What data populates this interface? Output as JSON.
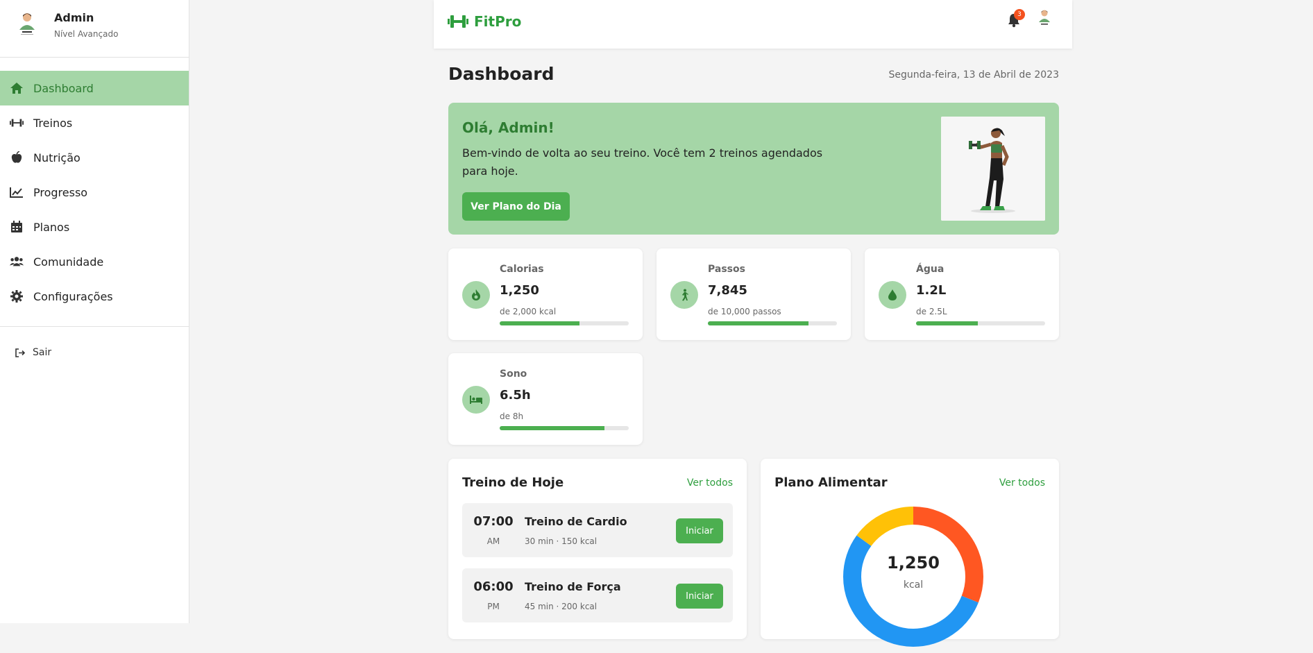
{
  "sidebar": {
    "user": {
      "name": "Admin",
      "level": "Nível Avançado"
    },
    "items": [
      {
        "label": "Dashboard",
        "icon": "home-icon",
        "active": true
      },
      {
        "label": "Treinos",
        "icon": "dumbbell-icon",
        "active": false
      },
      {
        "label": "Nutrição",
        "icon": "apple-icon",
        "active": false
      },
      {
        "label": "Progresso",
        "icon": "chart-line-icon",
        "active": false
      },
      {
        "label": "Planos",
        "icon": "calendar-icon",
        "active": false
      },
      {
        "label": "Comunidade",
        "icon": "users-icon",
        "active": false
      },
      {
        "label": "Configurações",
        "icon": "gear-icon",
        "active": false
      }
    ],
    "logout_label": "Sair"
  },
  "topbar": {
    "brand": "FitPro",
    "notification_count": "3"
  },
  "header": {
    "title": "Dashboard",
    "date": "Segunda-feira, 13 de Abril de 2023"
  },
  "banner": {
    "title": "Olá, Admin!",
    "text": "Bem-vindo de volta ao seu treino. Você tem 2 treinos agendados para hoje.",
    "button": "Ver Plano do Dia"
  },
  "stats": [
    {
      "label": "Calorias",
      "value": "1,250",
      "sub": "de 2,000 kcal",
      "progress": 0.62,
      "icon": "fire-icon"
    },
    {
      "label": "Passos",
      "value": "7,845",
      "sub": "de 10,000 passos",
      "progress": 0.78,
      "icon": "walking-icon"
    },
    {
      "label": "Água",
      "value": "1.2L",
      "sub": "de 2.5L",
      "progress": 0.48,
      "icon": "water-drop-icon"
    },
    {
      "label": "Sono",
      "value": "6.5h",
      "sub": "de 8h",
      "progress": 0.81,
      "icon": "bed-icon"
    }
  ],
  "workouts": {
    "title": "Treino de Hoje",
    "link": "Ver todos",
    "items": [
      {
        "time": "07:00",
        "ampm": "AM",
        "name": "Treino de Cardio",
        "meta": "30 min · 150 kcal",
        "button": "Iniciar"
      },
      {
        "time": "06:00",
        "ampm": "PM",
        "name": "Treino de Força",
        "meta": "45 min · 200 kcal",
        "button": "Iniciar"
      }
    ]
  },
  "meal_plan": {
    "title": "Plano Alimentar",
    "link": "Ver todos",
    "total": "1,250",
    "unit": "kcal"
  },
  "colors": {
    "accent": "#4caf50",
    "accent_light": "#a5d6a7",
    "accent_dark": "#2e7d32",
    "donut": [
      "#ff5722",
      "#2196f3",
      "#ffc107"
    ]
  },
  "chart_data": {
    "type": "pie",
    "title": "",
    "center_value": "1,250",
    "center_unit": "kcal",
    "slices": [
      {
        "value": 0.31,
        "color": "#ff5722"
      },
      {
        "value": 0.54,
        "color": "#2196f3"
      },
      {
        "value": 0.15,
        "color": "#ffc107"
      }
    ]
  }
}
